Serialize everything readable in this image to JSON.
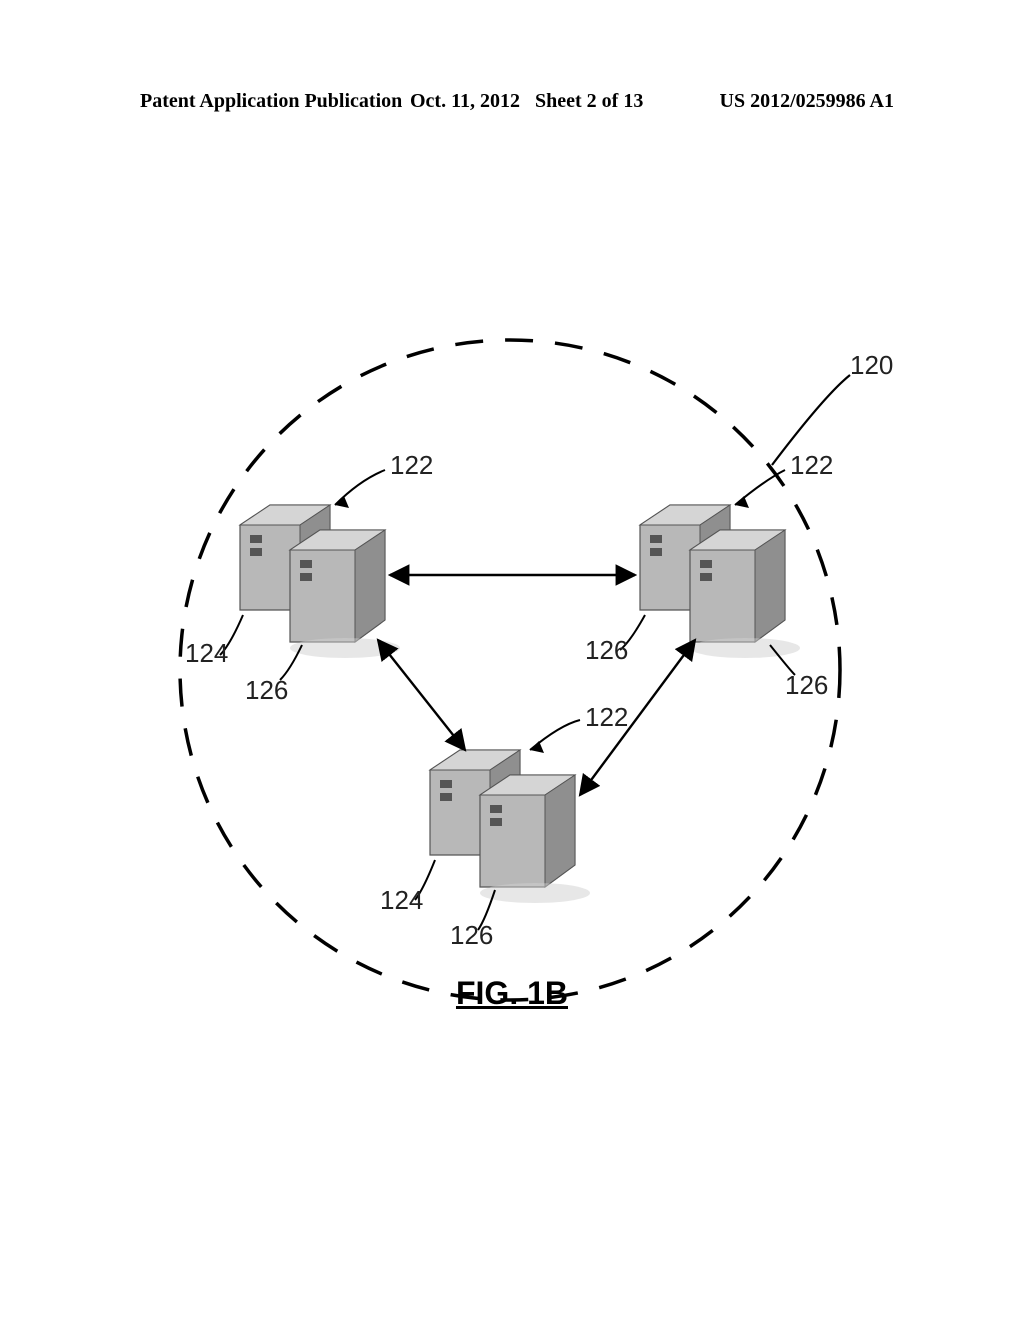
{
  "header": {
    "left": "Patent Application Publication",
    "date": "Oct. 11, 2012",
    "sheet": "Sheet 2 of 13",
    "pubnum": "US 2012/0259986 A1"
  },
  "figure": {
    "caption": "FIG. 1B",
    "labels": {
      "boundary": "120",
      "node_tl": "122",
      "node_tr": "122",
      "node_b": "122",
      "server_tl_back": "124",
      "server_tl_front": "126",
      "server_tr_back": "126",
      "server_tr_front": "126",
      "server_b_back": "124",
      "server_b_front": "126"
    }
  }
}
